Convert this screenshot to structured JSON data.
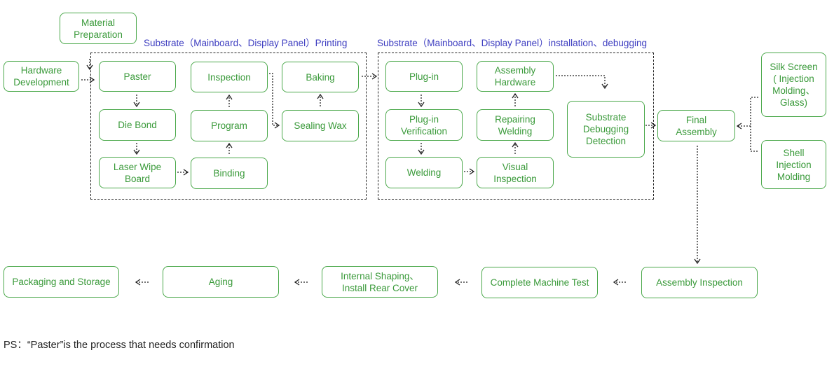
{
  "groups": {
    "printing": "Substrate（Mainboard、Display Panel）Printing",
    "installation": "Substrate（Mainboard、Display Panel）installation、debugging"
  },
  "nodes": {
    "material_preparation": "Material\nPreparation",
    "hardware_development": "Hardware\nDevelopment",
    "paster": "Paster",
    "die_bond": "Die Bond",
    "laser_wipe_board": "Laser Wipe\nBoard",
    "inspection": "Inspection",
    "program": "Program",
    "binding": "Binding",
    "baking": "Baking",
    "sealing_wax": "Sealing Wax",
    "plug_in": "Plug-in",
    "plug_in_verification": "Plug-in\nVerification",
    "welding": "Welding",
    "assembly_hardware": "Assembly\nHardware",
    "repairing_welding": "Repairing\nWelding",
    "visual_inspection": "Visual\nInspection",
    "substrate_debugging_detection": "Substrate\nDebugging\nDetection",
    "final_assembly": "Final\nAssembly",
    "silk_screen": "Silk Screen\n( Injection\nMolding、\nGlass)",
    "shell_injection_molding": "Shell\nInjection\nMolding",
    "assembly_inspection": "Assembly Inspection",
    "complete_machine_test": "Complete Machine Test",
    "internal_shaping": "Internal Shaping、\nInstall Rear Cover",
    "aging": "Aging",
    "packaging_and_storage": "Packaging and Storage"
  },
  "note": "PS：“Paster”is the process that needs confirmation",
  "colors": {
    "node_border": "#4aa84a",
    "node_text": "#3a9a3a",
    "group_label": "#3c3cc0",
    "connector": "#222222"
  }
}
